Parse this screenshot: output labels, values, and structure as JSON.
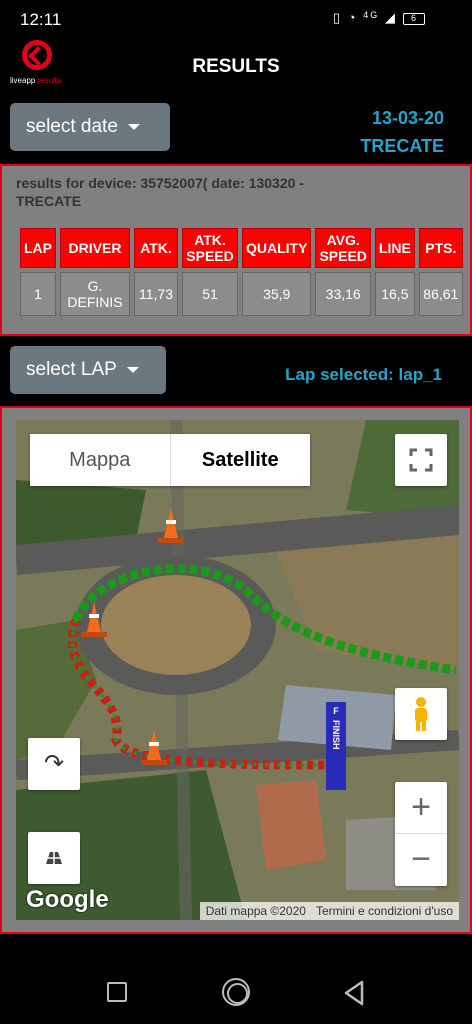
{
  "status_bar": {
    "time": "12:11",
    "icons": [
      "vibrate-icon",
      "wifi-icon",
      "signal-icon"
    ],
    "network": "4G",
    "battery": "6"
  },
  "app": {
    "logo_text": "liveapp",
    "logo_suffix": "results",
    "title": "RESULTS"
  },
  "date_select": {
    "label": "select date",
    "date": "13-03-20",
    "location": "TRECATE"
  },
  "results": {
    "header_line1": "results for device: 35752007(             date: 130320 -",
    "header_line2": "TRECATE",
    "columns": [
      "LAP",
      "DRIVER",
      "ATK.",
      "ATK. SPEED",
      "QUALITY",
      "AVG. SPEED",
      "LINE",
      "PTS."
    ],
    "rows": [
      {
        "lap": "1",
        "driver": "G. DEFINIS",
        "atk": "11,73",
        "atk_speed": "51",
        "quality": "35,9",
        "avg_speed": "33,16",
        "line": "16,5",
        "pts": "86,61"
      }
    ]
  },
  "lap_select": {
    "label": "select LAP",
    "selected_text": "Lap selected: lap_1"
  },
  "map": {
    "type_map": "Mappa",
    "type_satellite": "Satellite",
    "finish_label": "FINISH",
    "finish_prefix": "F",
    "google": "Google",
    "attribution_data": "Dati mappa ©2020",
    "attribution_terms": "Termini e condizioni d'uso",
    "zoom_in": "+",
    "zoom_out": "−",
    "rotate_icon": "↷"
  },
  "colors": {
    "accent": "#e0001b",
    "highlight_text": "#2aa3c8",
    "header_cell": "#ff0000",
    "button": "#6b7880"
  }
}
